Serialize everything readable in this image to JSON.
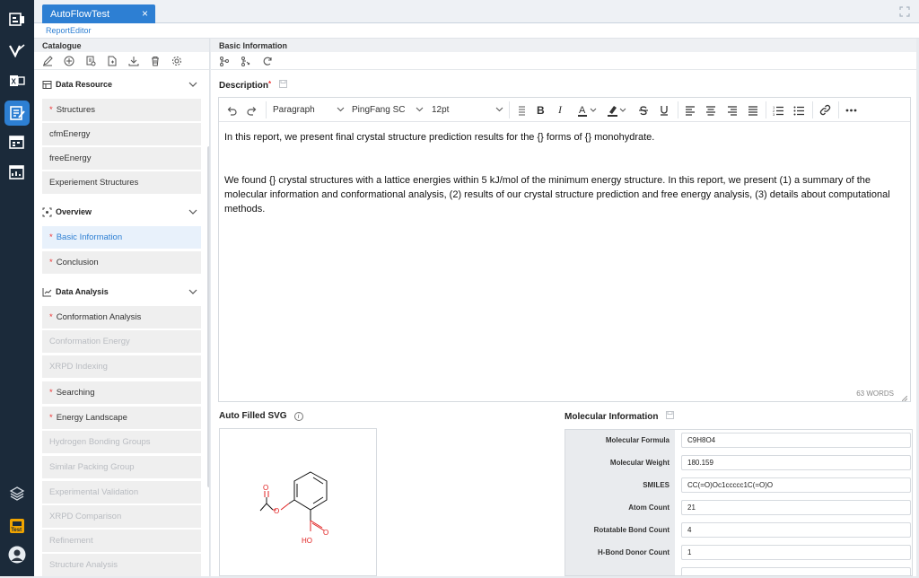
{
  "tab": {
    "label": "AutoFlowTest",
    "close": "×"
  },
  "subbar": {
    "label": "ReportEditor"
  },
  "catalogue": {
    "title": "Catalogue",
    "sections": [
      {
        "label": "Data Resource",
        "items": [
          {
            "label": "Structures",
            "required": true
          },
          {
            "label": "cfmEnergy",
            "required": false
          },
          {
            "label": "freeEnergy",
            "required": false
          },
          {
            "label": "Experiement Structures",
            "required": false
          }
        ]
      },
      {
        "label": "Overview",
        "items": [
          {
            "label": "Basic Information",
            "required": true,
            "selected": true
          },
          {
            "label": "Conclusion",
            "required": true
          }
        ]
      },
      {
        "label": "Data Analysis",
        "items": [
          {
            "label": "Conformation Analysis",
            "required": true
          },
          {
            "label": "Conformation Energy",
            "dim": true
          },
          {
            "label": "XRPD Indexing",
            "dim": true
          },
          {
            "label": "Searching",
            "required": true
          },
          {
            "label": "Energy Landscape",
            "required": true
          },
          {
            "label": "Hydrogen Bonding Groups",
            "dim": true
          },
          {
            "label": "Similar Packing Group",
            "dim": true
          },
          {
            "label": "Experimental Validation",
            "dim": true
          },
          {
            "label": "XRPD Comparison",
            "dim": true
          },
          {
            "label": "Refinement",
            "dim": true
          },
          {
            "label": "Structure Analysis",
            "dim": true
          }
        ]
      }
    ]
  },
  "main": {
    "title": "Basic Information",
    "description_label": "Description",
    "required_mark": "*",
    "editor": {
      "block_format": "Paragraph",
      "font": "PingFang SC",
      "size": "12pt",
      "paragraphs": [
        "In this report, we present final crystal structure prediction results for the {} forms of {} monohydrate.",
        "We found {} crystal structures with a lattice energies within 5 kJ/mol of the minimum energy structure. In this report, we present (1) a summary of the molecular information and conformational analysis, (2) results of our crystal structure prediction and free energy analysis, (3) details about computational methods."
      ],
      "word_count": "63 WORDS"
    },
    "svg_label": "Auto Filled SVG",
    "svg_info": "i",
    "molecule_atoms": {
      "o1": "O",
      "o2": "O",
      "o3": "O",
      "ho": "HO"
    },
    "molecular_label": "Molecular Information",
    "molecular": [
      {
        "key": "Molecular Formula",
        "value": "C9H8O4"
      },
      {
        "key": "Molecular Weight",
        "value": "180.159"
      },
      {
        "key": "SMILES",
        "value": "CC(=O)Oc1ccccc1C(=O)O"
      },
      {
        "key": "Atom Count",
        "value": "21"
      },
      {
        "key": "Rotatable Bond Count",
        "value": "4"
      },
      {
        "key": "H-Bond Donor Count",
        "value": "1"
      }
    ]
  },
  "colors": {
    "accent": "#2d7fd3",
    "rail": "#1b2a3a",
    "required": "#ee3333"
  },
  "rail_icons": [
    "dashboard-icon",
    "v-logo-icon",
    "excel-icon",
    "report-editor-icon",
    "calendar-icon",
    "chart-window-icon",
    "layers-icon",
    "test-badge-icon",
    "user-avatar"
  ],
  "rail_badge": "Test"
}
